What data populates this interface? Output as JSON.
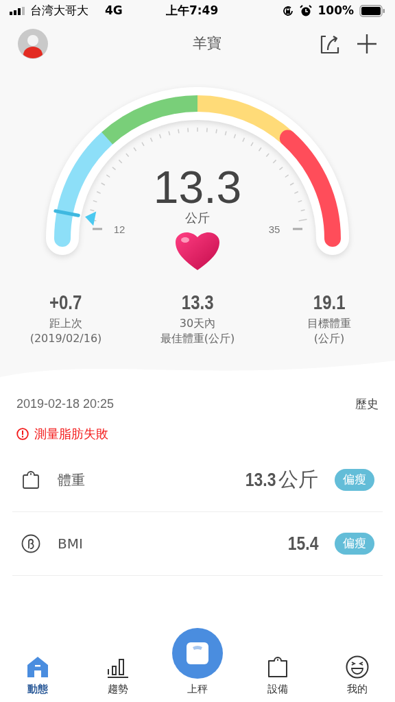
{
  "status_bar": {
    "carrier": "台湾大哥大",
    "network": "4G",
    "time": "上午7:49",
    "battery": "100%"
  },
  "header": {
    "title": "羊寶"
  },
  "gauge": {
    "value": "13.3",
    "unit": "公斤",
    "min_label": "12",
    "max_label": "35",
    "segments": [
      {
        "color": "#8ddff8"
      },
      {
        "color": "#79cf79"
      },
      {
        "color": "#ffdb78"
      },
      {
        "color": "#ff4d5a"
      }
    ]
  },
  "stats": [
    {
      "value": "+0.7",
      "label": [
        "距上次",
        "(2019/02/16)"
      ]
    },
    {
      "value": "13.3",
      "label": [
        "30天內",
        "最佳體重(公斤)"
      ]
    },
    {
      "value": "19.1",
      "label": [
        "目標體重",
        "(公斤)"
      ]
    }
  ],
  "record": {
    "datetime": "2019-02-18 20:25",
    "history": "歷史",
    "error": "測量脂肪失敗"
  },
  "metrics": [
    {
      "name": "體重",
      "value": "13.3",
      "unit": "公斤",
      "badge": "偏瘦",
      "color": "#63bdd8"
    },
    {
      "name": "BMI",
      "value": "15.4",
      "badge": "偏瘦",
      "color": "#63bdd8"
    }
  ],
  "nav": [
    {
      "label": "動態",
      "selected": true
    },
    {
      "label": "趨勢",
      "selected": false
    },
    {
      "label": "上秤",
      "selected": false,
      "kind": "center"
    },
    {
      "label": "設備",
      "selected": false
    },
    {
      "label": "我的",
      "selected": false
    }
  ]
}
